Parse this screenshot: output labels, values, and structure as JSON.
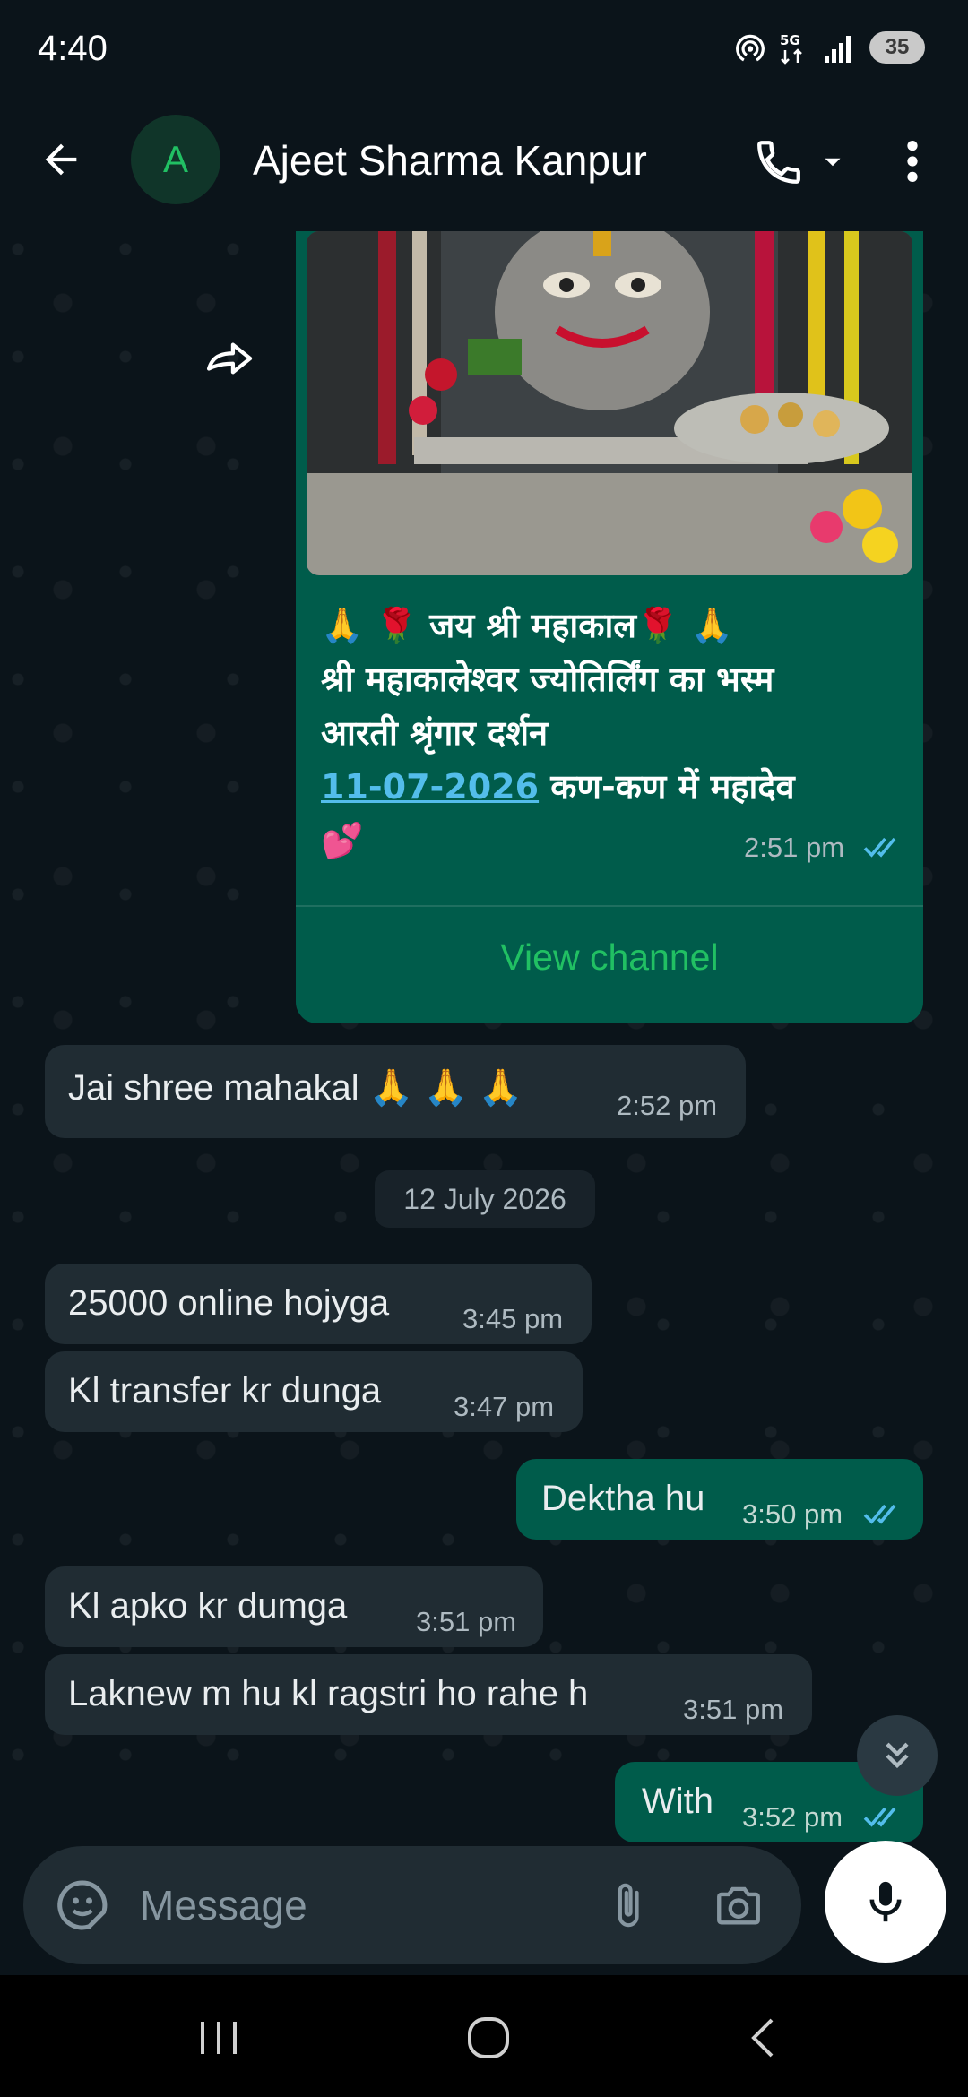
{
  "status_bar": {
    "time": "4:40",
    "battery": "35",
    "icons": [
      "hotspot-icon",
      "5g-icon",
      "signal-icon",
      "battery-icon"
    ]
  },
  "header": {
    "avatar_letter": "A",
    "contact_name": "Ajeet Sharma Kanpur",
    "icons": [
      "back-arrow-icon",
      "phone-icon",
      "chevron-down-icon",
      "more-vert-icon"
    ]
  },
  "channel_post": {
    "caption_line1": "🙏 🌹 जय श्री महाकाल🌹 🙏",
    "caption_line2": "श्री महाकालेश्वर ज्योतिर्लिंग का भस्म",
    "caption_line3": "आरती श्रृंगार दर्शन",
    "caption_date": "11-07-2026",
    "caption_after_date": " कण-कण में महादेव",
    "caption_line5": "💕",
    "time": "2:51 pm",
    "view_channel": "View channel"
  },
  "date_separator": "12 July 2026",
  "messages": [
    {
      "text": "Jai shree mahakal 🙏 🙏 🙏",
      "time": "2:52 pm",
      "direction": "in"
    },
    {
      "text": "25000 online hojyga",
      "time": "3:45 pm",
      "direction": "in"
    },
    {
      "text": "Kl transfer kr dunga",
      "time": "3:47 pm",
      "direction": "in"
    },
    {
      "text": "Dektha hu",
      "time": "3:50 pm",
      "direction": "out"
    },
    {
      "text": "Kl apko kr dumga",
      "time": "3:51 pm",
      "direction": "in"
    },
    {
      "text": "Laknew m hu kl ragstri ho rahe h",
      "time": "3:51 pm",
      "direction": "in"
    },
    {
      "text": "With",
      "time": "3:52 pm",
      "direction": "out"
    }
  ],
  "composer": {
    "placeholder": "Message"
  },
  "colors": {
    "background": "#0b141a",
    "incoming_bubble": "#202c33",
    "outgoing_bubble": "#005c4b",
    "accent_green": "#21c063",
    "read_tick_blue": "#53bdeb"
  }
}
